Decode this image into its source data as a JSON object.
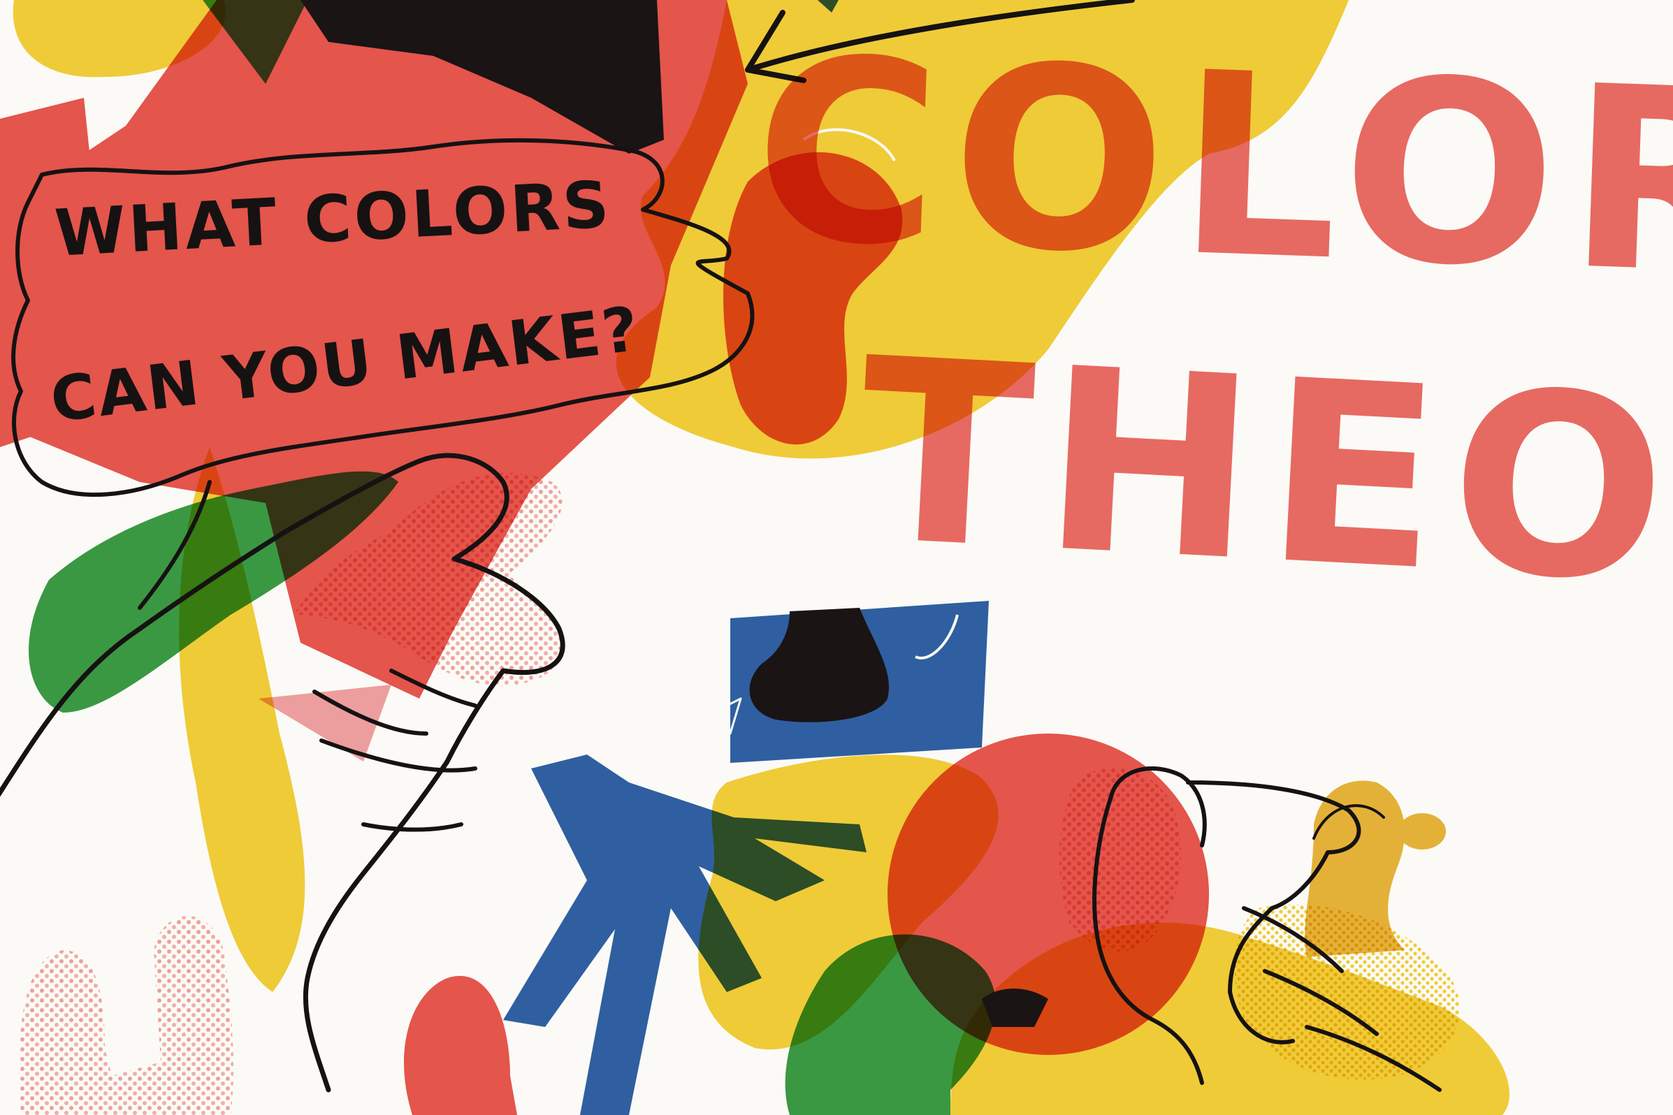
{
  "title": {
    "line1": "COLOR",
    "line2": "THEORY"
  },
  "speech_bubble": {
    "line1": "WHAT COLORS",
    "line2": "CAN YOU MAKE?"
  },
  "palette": {
    "red": "#e8574f",
    "yellow": "#f3cf3a",
    "blue": "#2f61a6",
    "green": "#3b9b45",
    "black": "#1a1414",
    "pink": "#f0a1a4",
    "paper": "#fbfaf6"
  }
}
